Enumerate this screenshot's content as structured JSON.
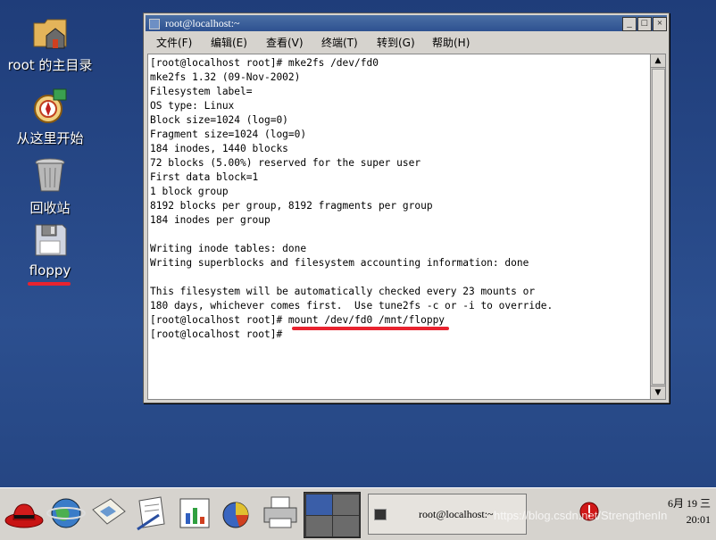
{
  "desktop": {
    "icons": [
      {
        "label": "root 的主目录",
        "icon": "home-folder-icon"
      },
      {
        "label": "从这里开始",
        "icon": "start-here-icon"
      },
      {
        "label": "回收站",
        "icon": "trash-icon"
      },
      {
        "label": "floppy",
        "icon": "floppy-icon"
      }
    ]
  },
  "window": {
    "title": "root@localhost:~",
    "minimize": "_",
    "maximize": "□",
    "close": "×",
    "menu": [
      "文件(F)",
      "编辑(E)",
      "查看(V)",
      "终端(T)",
      "转到(G)",
      "帮助(H)"
    ],
    "terminal_lines": [
      "[root@localhost root]# mke2fs /dev/fd0",
      "mke2fs 1.32 (09-Nov-2002)",
      "Filesystem label=",
      "OS type: Linux",
      "Block size=1024 (log=0)",
      "Fragment size=1024 (log=0)",
      "184 inodes, 1440 blocks",
      "72 blocks (5.00%) reserved for the super user",
      "First data block=1",
      "1 block group",
      "8192 blocks per group, 8192 fragments per group",
      "184 inodes per group",
      "",
      "Writing inode tables: done",
      "Writing superblocks and filesystem accounting information: done",
      "",
      "This filesystem will be automatically checked every 23 mounts or",
      "180 days, whichever comes first.  Use tune2fs -c or -i to override.",
      "[root@localhost root]# mount /dev/fd0 /mnt/floppy",
      "[root@localhost root]# "
    ]
  },
  "taskbar": {
    "task_title": "root@localhost:~",
    "clock_date": "6月 19 三",
    "clock_time": "20:01",
    "launchers": [
      "redhat-menu-icon",
      "web-browser-icon",
      "email-icon",
      "writer-icon",
      "presentation-icon",
      "spreadsheet-icon",
      "printer-icon"
    ]
  },
  "watermark": "https://blog.csdn.net/StrengthenIn",
  "colors": {
    "annotation": "#e8232f",
    "titlebar": "#2e5190"
  }
}
